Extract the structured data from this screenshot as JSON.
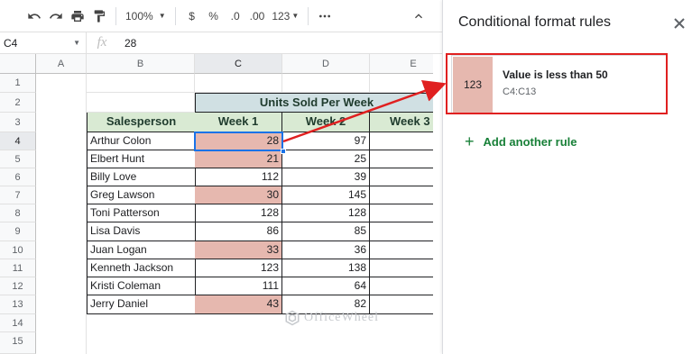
{
  "toolbar": {
    "zoom": "100%",
    "currency": "$",
    "percent": "%",
    "dec_less": ".0",
    "dec_more": ".00",
    "more_formats": "123"
  },
  "formula_bar": {
    "cell_ref": "C4",
    "fx": "fx",
    "value": "28"
  },
  "columns": [
    "A",
    "B",
    "C",
    "D",
    "E"
  ],
  "rows": [
    "1",
    "2",
    "3",
    "4",
    "5",
    "6",
    "7",
    "8",
    "9",
    "10",
    "11",
    "12",
    "13",
    "14",
    "15"
  ],
  "table": {
    "band_title": "Units Sold Per Week",
    "headers": [
      "Salesperson",
      "Week 1",
      "Week 2",
      "Week 3"
    ],
    "data": [
      {
        "name": "Arthur Colon",
        "w1": "28",
        "w2": "97"
      },
      {
        "name": "Elbert Hunt",
        "w1": "21",
        "w2": "25"
      },
      {
        "name": "Billy Love",
        "w1": "112",
        "w2": "39"
      },
      {
        "name": "Greg Lawson",
        "w1": "30",
        "w2": "145"
      },
      {
        "name": "Toni Patterson",
        "w1": "128",
        "w2": "128"
      },
      {
        "name": "Lisa Davis",
        "w1": "86",
        "w2": "85"
      },
      {
        "name": "Juan Logan",
        "w1": "33",
        "w2": "36"
      },
      {
        "name": "Kenneth Jackson",
        "w1": "123",
        "w2": "138"
      },
      {
        "name": "Kristi Coleman",
        "w1": "111",
        "w2": "64"
      },
      {
        "name": "Jerry Daniel",
        "w1": "43",
        "w2": "82"
      }
    ]
  },
  "panel": {
    "title": "Conditional format rules",
    "rule": {
      "preview": "123",
      "condition": "Value is less than 50",
      "range": "C4:C13",
      "highlight_color": "#e6b8af"
    },
    "add_rule": "Add another rule"
  },
  "watermark": "OfficeWheel"
}
